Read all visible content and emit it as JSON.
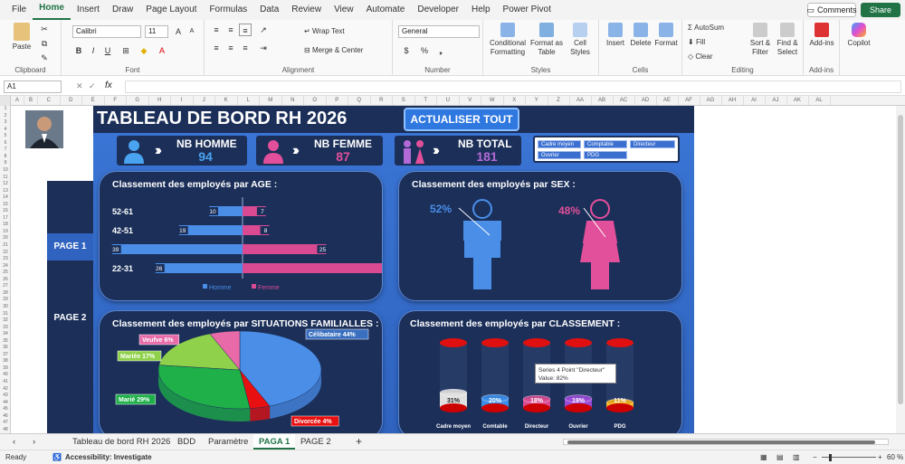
{
  "menu": {
    "items": [
      "File",
      "Home",
      "Insert",
      "Draw",
      "Page Layout",
      "Formulas",
      "Data",
      "Review",
      "View",
      "Automate",
      "Developer",
      "Help",
      "Power Pivot"
    ],
    "comments": "Comments",
    "share": "Share"
  },
  "ribbon": {
    "paste": "Paste",
    "clipboard": "Clipboard",
    "font_name": "Calibri",
    "font_size": "11",
    "font": "Font",
    "wrap": "Wrap Text",
    "merge": "Merge & Center",
    "alignment": "Alignment",
    "numfmt": "General",
    "number": "Number",
    "cond": "Conditional Formatting",
    "fmt_table": "Format as Table",
    "cell_styles": "Cell Styles",
    "styles": "Styles",
    "insert": "Insert",
    "delete": "Delete",
    "format": "Format",
    "cells": "Cells",
    "autosum": "AutoSum",
    "fill": "Fill",
    "clear": "Clear",
    "sort": "Sort & Filter",
    "find": "Find & Select",
    "editing": "Editing",
    "addins": "Add-ins",
    "addins_grp": "Add-ins",
    "copilot": "Copilot"
  },
  "formula": {
    "cell_ref": "A1",
    "fx": "fx",
    "value": ""
  },
  "columns": [
    "A",
    "B",
    "C",
    "D",
    "E",
    "F",
    "G",
    "H",
    "I",
    "J",
    "K",
    "L",
    "M",
    "N",
    "O",
    "P",
    "Q",
    "R",
    "S",
    "T",
    "U",
    "V",
    "W",
    "X",
    "Y",
    "Z",
    "AA",
    "AB",
    "AC",
    "AD",
    "AE",
    "AF",
    "AG",
    "AH",
    "AI",
    "AJ",
    "AK",
    "AL"
  ],
  "side": {
    "page1": "PAGE 1",
    "page2": "PAGE 2"
  },
  "dash": {
    "title": "TABLEAU DE BORD RH 2026",
    "refresh": "ACTUALISER TOUT",
    "kpi": [
      {
        "label": "NB HOMME",
        "value": "94",
        "color": "#4aa3f0"
      },
      {
        "label": "NB FEMME",
        "value": "87",
        "color": "#e24f9a"
      },
      {
        "label": "NB TOTAL",
        "value": "181",
        "color": "#b46ad6"
      }
    ],
    "slicer": [
      "Cadre moyen",
      "Comptable",
      "Directeur",
      "Ouvrier",
      "PDG"
    ]
  },
  "age_card": {
    "title": "Classement des employés par AGE :"
  },
  "sex_card": {
    "title": "Classement des employés par SEX :",
    "male_pct": "52%",
    "female_pct": "48%"
  },
  "fam_card": {
    "title": "Classement des employés par SITUATIONS FAMILIALLES :"
  },
  "cls_card": {
    "title": "Classement des employés par CLASSEMENT :",
    "tooltip_1": "Series 4 Point \"Directeur\"",
    "tooltip_2": "Value: 82%"
  },
  "chart_data": [
    {
      "type": "bar",
      "orientation": "horizontal",
      "categories": [
        "52-61",
        "42-51",
        "32-41",
        "22-31"
      ],
      "series": [
        {
          "name": "Homme",
          "values": [
            10,
            19,
            39,
            26
          ],
          "color": "#4a8ee8"
        },
        {
          "name": "Femme",
          "values": [
            7,
            8,
            25,
            47
          ],
          "color": "#d94a92"
        }
      ]
    },
    {
      "type": "pie",
      "labels": [
        "Célibataire",
        "Divorcée",
        "Marié",
        "Mariée",
        "Veufve"
      ],
      "values": [
        44,
        4,
        29,
        17,
        6
      ],
      "colors": [
        "#4a8ee8",
        "#e81010",
        "#1fb04a",
        "#8fd14a",
        "#e86aa8"
      ]
    },
    {
      "type": "bar",
      "categories": [
        "Cadre moyen",
        "Comtable",
        "Directeur",
        "Ouvrier",
        "PDG"
      ],
      "values": [
        31,
        20,
        18,
        19,
        11
      ],
      "colors": [
        "#e0e0e0",
        "#3a8ee8",
        "#d94a92",
        "#9a4ad6",
        "#f0b020"
      ]
    }
  ],
  "tabs": [
    "Tableau de bord RH 2026",
    "BDD",
    "Paramètre",
    "PAGA 1",
    "PAGE 2"
  ],
  "status": {
    "ready": "Ready",
    "access": "Accessibility: Investigate",
    "zoom": "60 %"
  }
}
